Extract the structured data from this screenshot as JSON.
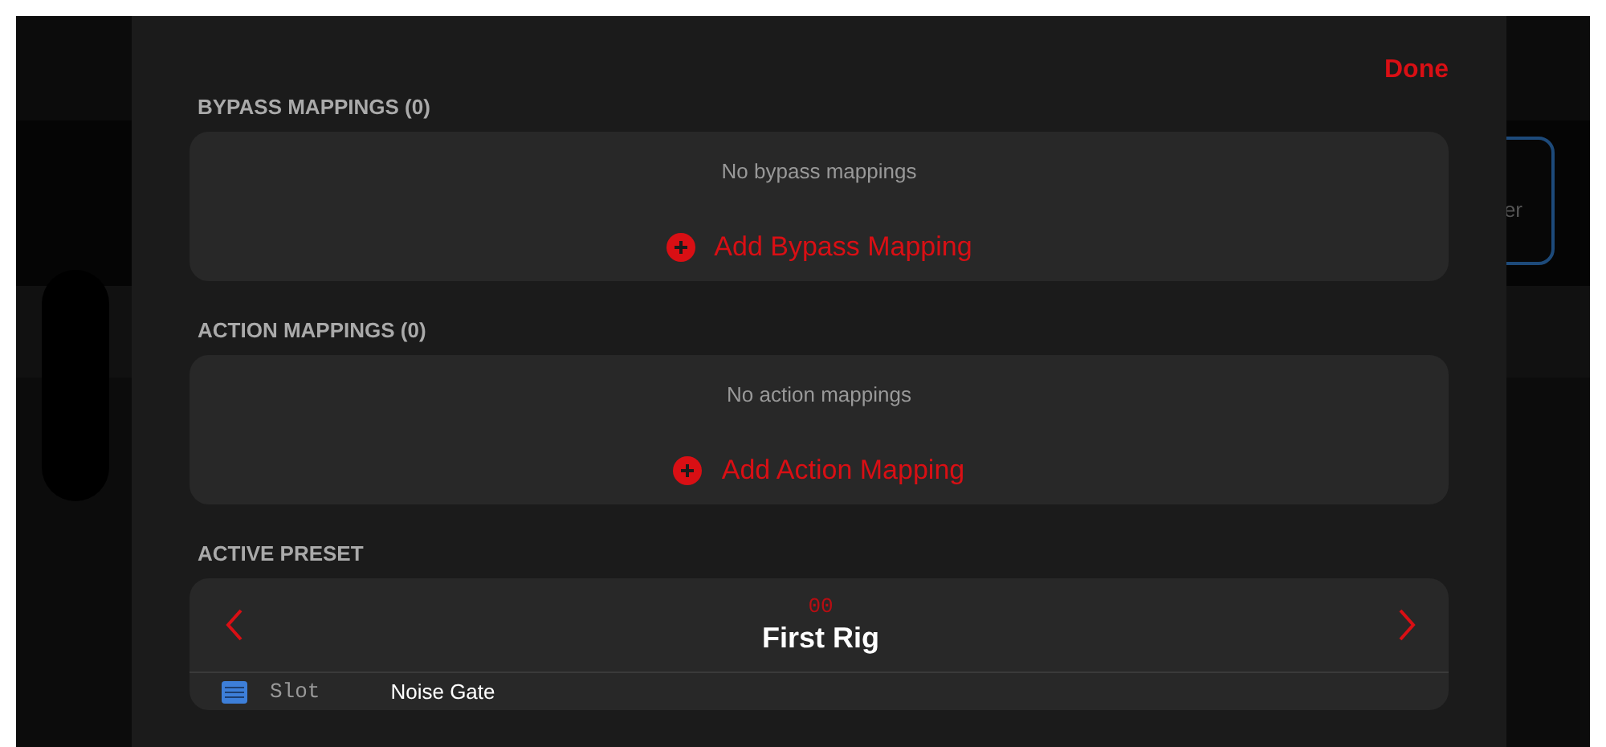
{
  "background": {
    "card_text": "er"
  },
  "sheet": {
    "done_button": "Done",
    "sections": [
      {
        "title": "BYPASS MAPPINGS (0)",
        "empty_text": "No bypass mappings",
        "add_button": "Add Bypass Mapping"
      },
      {
        "title": "ACTION MAPPINGS (0)",
        "empty_text": "No action mappings",
        "add_button": "Add Action Mapping"
      }
    ],
    "active_preset": {
      "title": "ACTIVE PRESET",
      "number": "00",
      "name": "First Rig",
      "slots": [
        {
          "label": "Slot",
          "name": "Noise Gate"
        }
      ]
    }
  }
}
